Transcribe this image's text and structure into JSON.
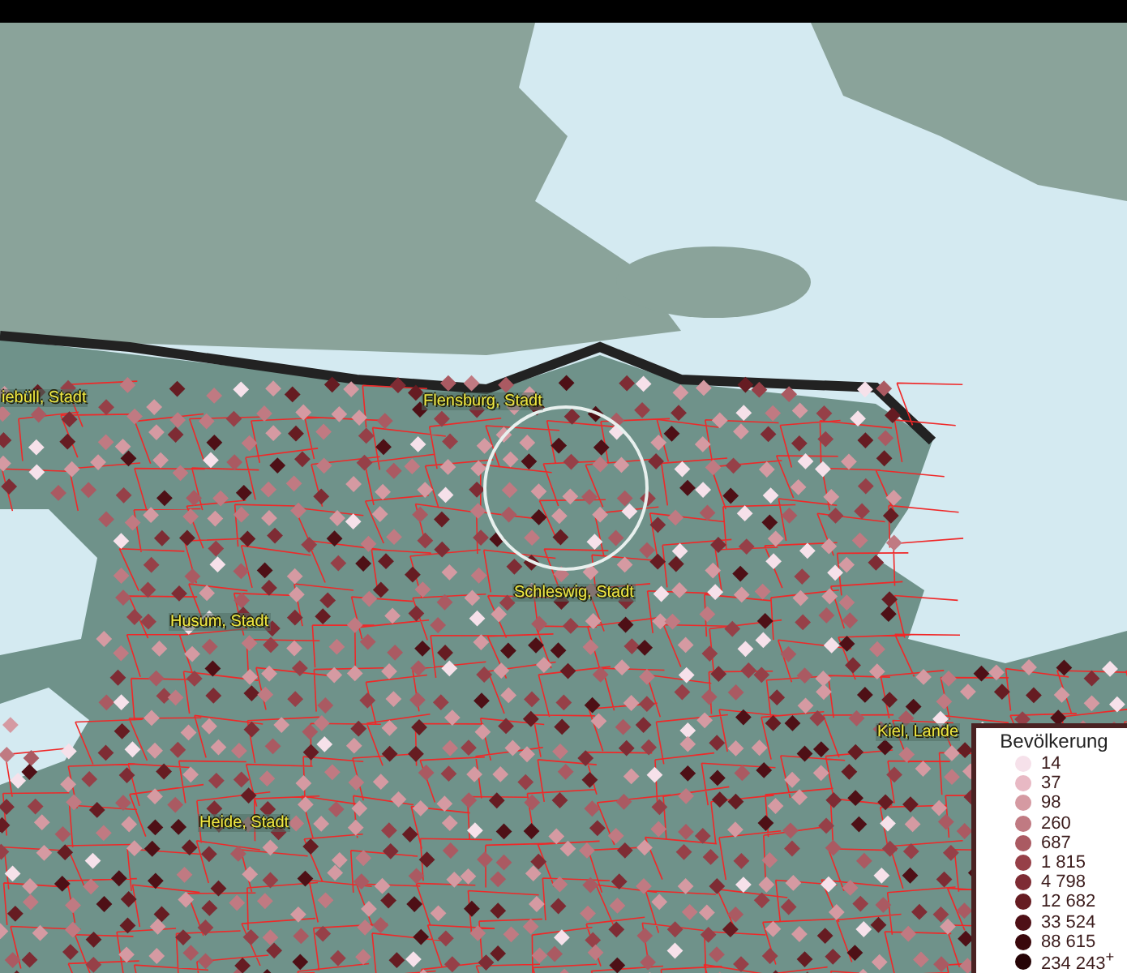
{
  "map": {
    "place_labels": [
      {
        "text": "iebüll, Stadt"
      },
      {
        "text": "Flensburg, Stadt"
      },
      {
        "text": "Schleswig, Stadt"
      },
      {
        "text": "Husum, Stadt"
      },
      {
        "text": "Kiel, Lande"
      },
      {
        "text": "Heide, Stadt"
      }
    ]
  },
  "legend": {
    "title": "Bevölkerung",
    "items": [
      {
        "label": "14",
        "color": "#f6e1ea"
      },
      {
        "label": "37",
        "color": "#e8b9c4"
      },
      {
        "label": "98",
        "color": "#d59aa2"
      },
      {
        "label": "260",
        "color": "#c07a82"
      },
      {
        "label": "687",
        "color": "#aa5a62"
      },
      {
        "label": "1 815",
        "color": "#964048"
      },
      {
        "label": "4 798",
        "color": "#7e2c34"
      },
      {
        "label": "12 682",
        "color": "#661c22"
      },
      {
        "label": "33 524",
        "color": "#4e1016"
      },
      {
        "label": "88 615",
        "color": "#3a080c"
      },
      {
        "label": "234 243$^{+}$",
        "color": "#260406"
      }
    ]
  }
}
